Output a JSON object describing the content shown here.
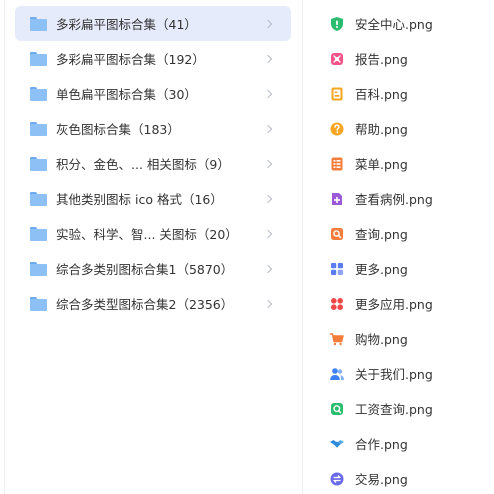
{
  "folders": [
    {
      "label": "多彩扁平图标合集（41）",
      "active": true
    },
    {
      "label": "多彩扁平图标合集（192）",
      "active": false
    },
    {
      "label": "单色扁平图标合集（30）",
      "active": false
    },
    {
      "label": "灰色图标合集（183）",
      "active": false
    },
    {
      "label": "积分、金色、...  相关图标（9）",
      "active": false
    },
    {
      "label": "其他类别图标 ico 格式（16）",
      "active": false
    },
    {
      "label": "实验、科学、智... 关图标（20）",
      "active": false
    },
    {
      "label": "综合多类别图标合集1（5870）",
      "active": false
    },
    {
      "label": "综合多类型图标合集2（2356）",
      "active": false
    }
  ],
  "files": [
    {
      "label": "安全中心.png",
      "icon": "shield-icon",
      "color": "#2bbd6e"
    },
    {
      "label": "报告.png",
      "icon": "report-icon",
      "color": "#f2548a"
    },
    {
      "label": "百科.png",
      "icon": "book-icon",
      "color": "#f5a623"
    },
    {
      "label": "帮助.png",
      "icon": "help-icon",
      "color": "#f5a623"
    },
    {
      "label": "菜单.png",
      "icon": "menu-icon",
      "color": "#f57c3a"
    },
    {
      "label": "查看病例.png",
      "icon": "medical-record-icon",
      "color": "#9b59d6"
    },
    {
      "label": "查询.png",
      "icon": "search-doc-icon",
      "color": "#f57c3a"
    },
    {
      "label": "更多.png",
      "icon": "grid-icon",
      "color": "#5b7cf2"
    },
    {
      "label": "更多应用.png",
      "icon": "apps-icon",
      "color": "#f04848"
    },
    {
      "label": "购物.png",
      "icon": "cart-icon",
      "color": "#f57c3a"
    },
    {
      "label": "关于我们.png",
      "icon": "users-icon",
      "color": "#3b82f6"
    },
    {
      "label": "工资查询.png",
      "icon": "salary-icon",
      "color": "#2bbd6e"
    },
    {
      "label": "合作.png",
      "icon": "handshake-icon",
      "color": "#2e8bd8"
    },
    {
      "label": "交易.png",
      "icon": "exchange-icon",
      "color": "#6a6ae8"
    }
  ]
}
